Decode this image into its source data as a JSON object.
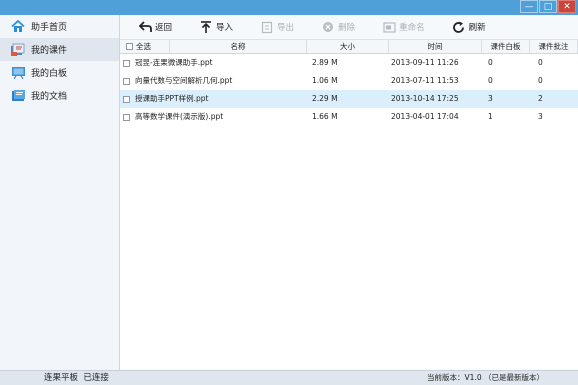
{
  "window": {
    "controls": {
      "minimize": "—",
      "maximize": "□",
      "close": "✕"
    }
  },
  "sidebar": {
    "items": [
      {
        "label": "助手首页",
        "icon": "home-icon",
        "active": false
      },
      {
        "label": "我的课件",
        "icon": "courseware-icon",
        "active": true
      },
      {
        "label": "我的白板",
        "icon": "whiteboard-icon",
        "active": false
      },
      {
        "label": "我的文档",
        "icon": "document-icon",
        "active": false
      }
    ]
  },
  "toolbar": {
    "back": "返回",
    "import": "导入",
    "export": "导出",
    "delete": "删除",
    "rename": "重命名",
    "refresh": "刷新"
  },
  "table": {
    "headers": {
      "select_all": "全选",
      "name": "名称",
      "size": "大小",
      "time": "时间",
      "whiteboard": "课件白板",
      "annotation": "课件批注"
    },
    "rows": [
      {
        "name": "冠昱-连果微课助手.ppt",
        "size": "2.89 M",
        "time": "2013-09-11 11:26",
        "whiteboard": "0",
        "annotation": "0",
        "selected": false
      },
      {
        "name": "向量代数与空间解析几何.ppt",
        "size": "1.06 M",
        "time": "2013-07-11 11:53",
        "whiteboard": "0",
        "annotation": "0",
        "selected": false
      },
      {
        "name": "授课助手PPT样例.ppt",
        "size": "2.29 M",
        "time": "2013-10-14 17:25",
        "whiteboard": "3",
        "annotation": "2",
        "selected": true
      },
      {
        "name": "高等数学课件(演示版).ppt",
        "size": "1.66 M",
        "time": "2013-04-01 17:04",
        "whiteboard": "1",
        "annotation": "3",
        "selected": false
      }
    ]
  },
  "status": {
    "device": "连果平板",
    "connection": "已连接",
    "version": "当前版本：V1.0 （已是最新版本）"
  },
  "colors": {
    "titlebar": "#4f9fd8",
    "selected_row": "#dbeefb",
    "sidebar_active": "#dfe6ee",
    "close_button": "#c9463d"
  }
}
